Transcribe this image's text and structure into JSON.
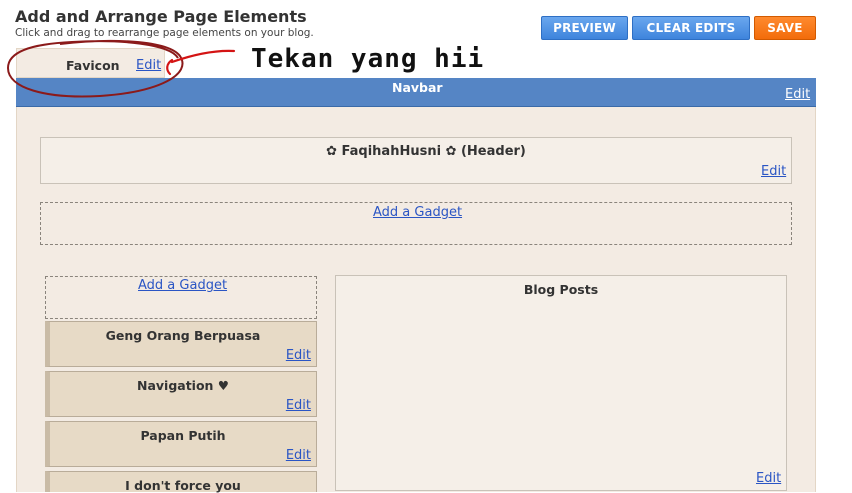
{
  "header": {
    "title": "Add and Arrange Page Elements",
    "subtitle": "Click and drag to rearrange page elements on your blog."
  },
  "toolbar": {
    "preview_label": "PREVIEW",
    "clear_label": "CLEAR EDITS",
    "save_label": "SAVE"
  },
  "favicon": {
    "label": "Favicon",
    "edit": "Edit"
  },
  "navbar": {
    "label": "Navbar",
    "edit": "Edit"
  },
  "blog_header": {
    "label": "✿ FaqihahHusni ✿ (Header)",
    "edit": "Edit"
  },
  "add_gadget_top": "Add a Gadget",
  "sidebar": {
    "add_gadget": "Add a Gadget",
    "gadgets": [
      {
        "title": "Geng Orang Berpuasa",
        "edit": "Edit"
      },
      {
        "title": "Navigation ♥",
        "edit": "Edit"
      },
      {
        "title": "Papan Putih",
        "edit": "Edit"
      },
      {
        "title": "I don't force you",
        "edit": "Edit"
      }
    ]
  },
  "blog_posts": {
    "label": "Blog Posts",
    "edit": "Edit"
  },
  "annotation": {
    "text": "Tekan yang hii",
    "color": "#8b1a1a"
  },
  "colors": {
    "navbar": "#5585c5",
    "button_blue": "#3e84dc",
    "button_orange": "#f26c0b",
    "link": "#2a55c4"
  }
}
